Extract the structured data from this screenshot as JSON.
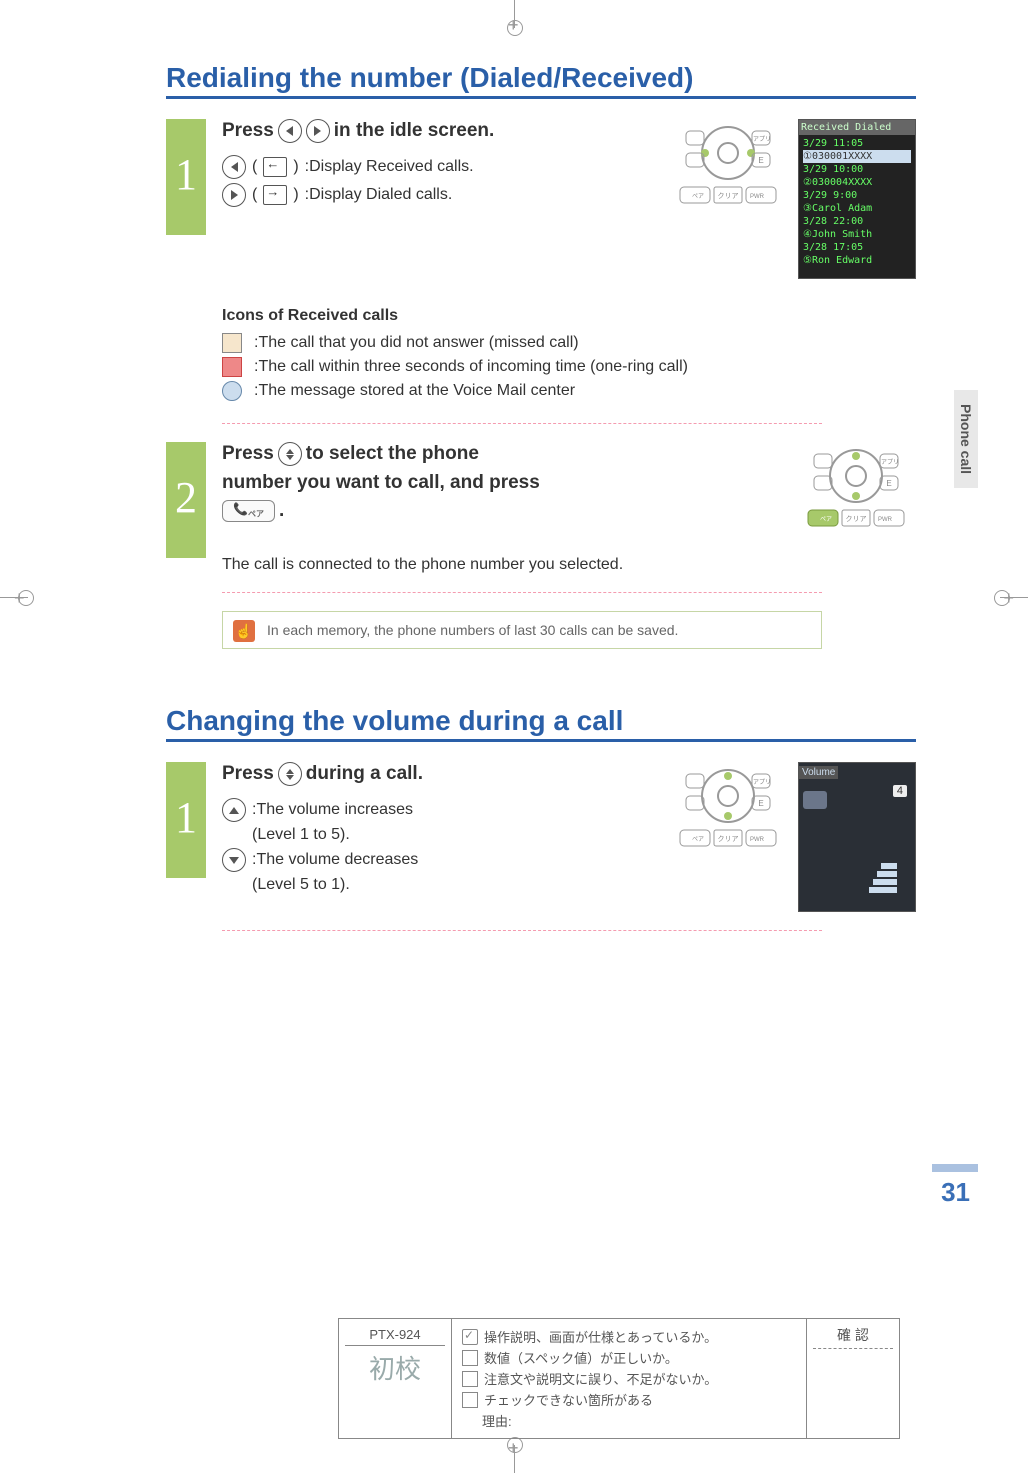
{
  "side_tab": "Phone call",
  "page_number": "31",
  "section1": {
    "title": "Redialing the number (Dialed/Received)",
    "step1": {
      "num": "1",
      "title_a": "Press",
      "title_b": "in the idle screen.",
      "left_desc": ":Display Received calls.",
      "right_desc": ":Display Dialed calls."
    },
    "icons_header": "Icons of Received calls",
    "icon_line1": ":The call that you did not answer (missed call)",
    "icon_line2": ":The call within three seconds of incoming time (one-ring call)",
    "icon_line3": ":The message stored at the Voice Mail center",
    "step2": {
      "num": "2",
      "title_a": "Press",
      "title_b": "to select the phone",
      "title_c": "number you want to call, and press",
      "result": "The call is connected to the phone number you selected."
    },
    "hint": "In each memory, the phone numbers of last 30 calls can be saved.",
    "screenshot": {
      "header": "Received   Dialed",
      "rows": [
        "  3/29  11:05",
        "①030001XXXX",
        "  3/29  10:00",
        "②030004XXXX",
        "  3/29   9:00",
        "③Carol Adam",
        "  3/28  22:00",
        "④John Smith",
        "  3/28  17:05",
        "⑤Ron Edward"
      ]
    }
  },
  "section2": {
    "title": "Changing the volume during a call",
    "step1": {
      "num": "1",
      "title_a": "Press",
      "title_b": "during a call.",
      "up_desc": ":The volume increases",
      "up_range": "(Level 1 to 5).",
      "down_desc": ":The volume decreases",
      "down_range": "(Level 5 to 1).",
      "screen_label": "Volume",
      "screen_level": "4"
    }
  },
  "footer": {
    "code": "PTX-924",
    "proof": "初校",
    "check1": "操作説明、画面が仕様とあっているか。",
    "check2": "数値（スペック値）が正しいか。",
    "check3": "注意文や説明文に誤り、不足がないか。",
    "check4": "チェックできない箇所がある",
    "reason": "理由:",
    "confirm": "確 認"
  },
  "keypad_labels": {
    "clear": "クリア",
    "pwr": "PWR",
    "app": "アプリ",
    "pair": "ペア",
    "e": "E"
  }
}
